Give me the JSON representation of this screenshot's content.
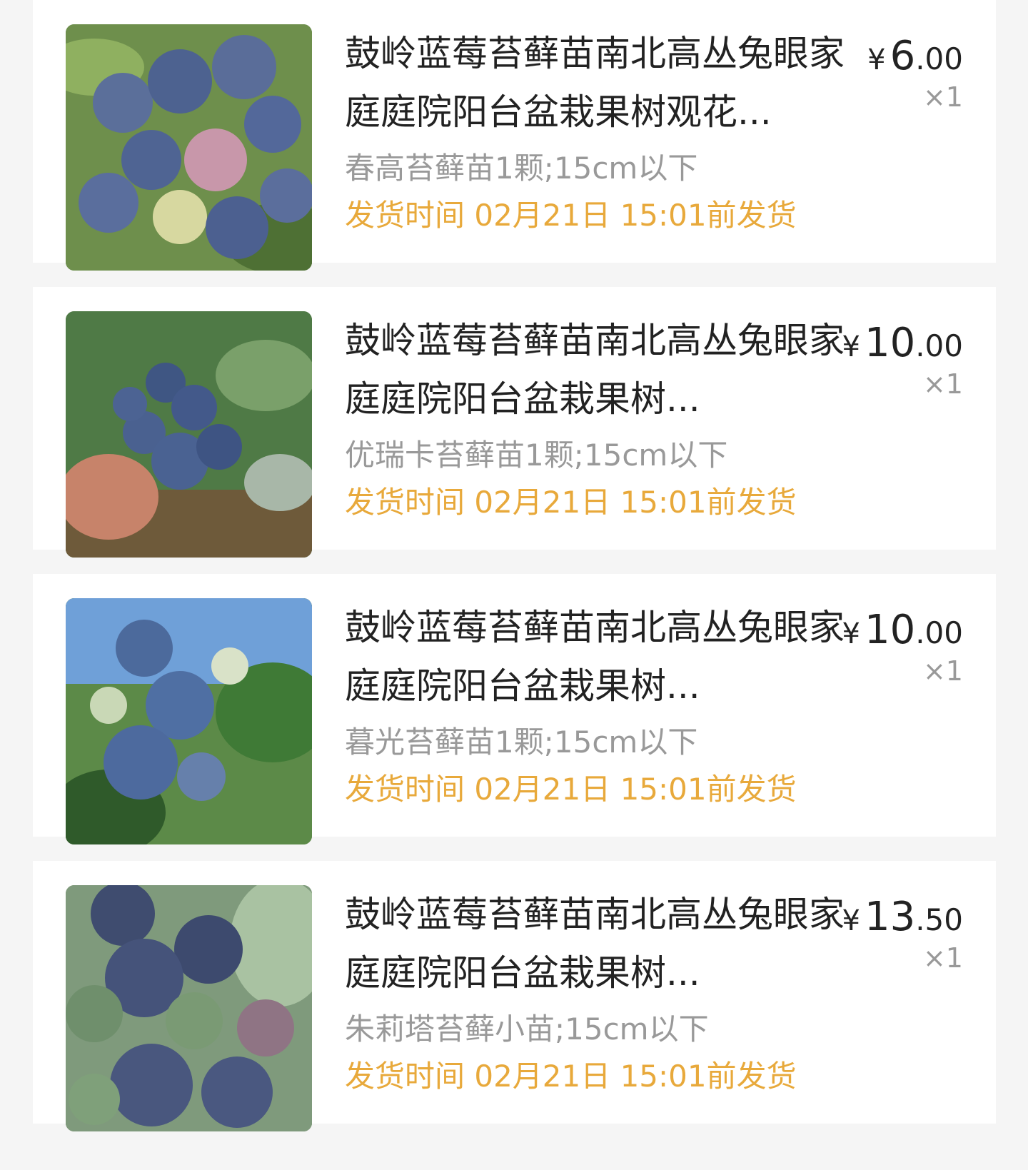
{
  "colors": {
    "ship_text": "#e8a93b",
    "title_text": "#222222",
    "muted_text": "#999999",
    "card_bg": "#ffffff",
    "page_bg": "#f5f5f5"
  },
  "items": [
    {
      "title": "鼓岭蓝莓苔藓苗南北高丛兔眼家庭庭院阳台盆栽果树观花...",
      "sku": "春高苔藓苗1颗;15cm以下",
      "ship": "发货时间 02月21日 15:01前发货",
      "price_currency": "¥",
      "price_int": "6",
      "price_dec": ".00",
      "qty": "×1",
      "image": "blueberry-cluster-photo"
    },
    {
      "title": "鼓岭蓝莓苔藓苗南北高丛兔眼家庭庭院阳台盆栽果树...",
      "sku": "优瑞卡苔藓苗1颗;15cm以下",
      "ship": "发货时间 02月21日 15:01前发货",
      "price_currency": "¥",
      "price_int": "10",
      "price_dec": ".00",
      "qty": "×1",
      "image": "blueberry-cluster-photo"
    },
    {
      "title": "鼓岭蓝莓苔藓苗南北高丛兔眼家庭庭院阳台盆栽果树...",
      "sku": "暮光苔藓苗1颗;15cm以下",
      "ship": "发货时间 02月21日 15:01前发货",
      "price_currency": "¥",
      "price_int": "10",
      "price_dec": ".00",
      "qty": "×1",
      "image": "blueberry-cluster-photo"
    },
    {
      "title": "鼓岭蓝莓苔藓苗南北高丛兔眼家庭庭院阳台盆栽果树...",
      "sku": "朱莉塔苔藓小苗;15cm以下",
      "ship": "发货时间 02月21日 15:01前发货",
      "price_currency": "¥",
      "price_int": "13",
      "price_dec": ".50",
      "qty": "×1",
      "image": "blueberry-cluster-photo"
    }
  ]
}
